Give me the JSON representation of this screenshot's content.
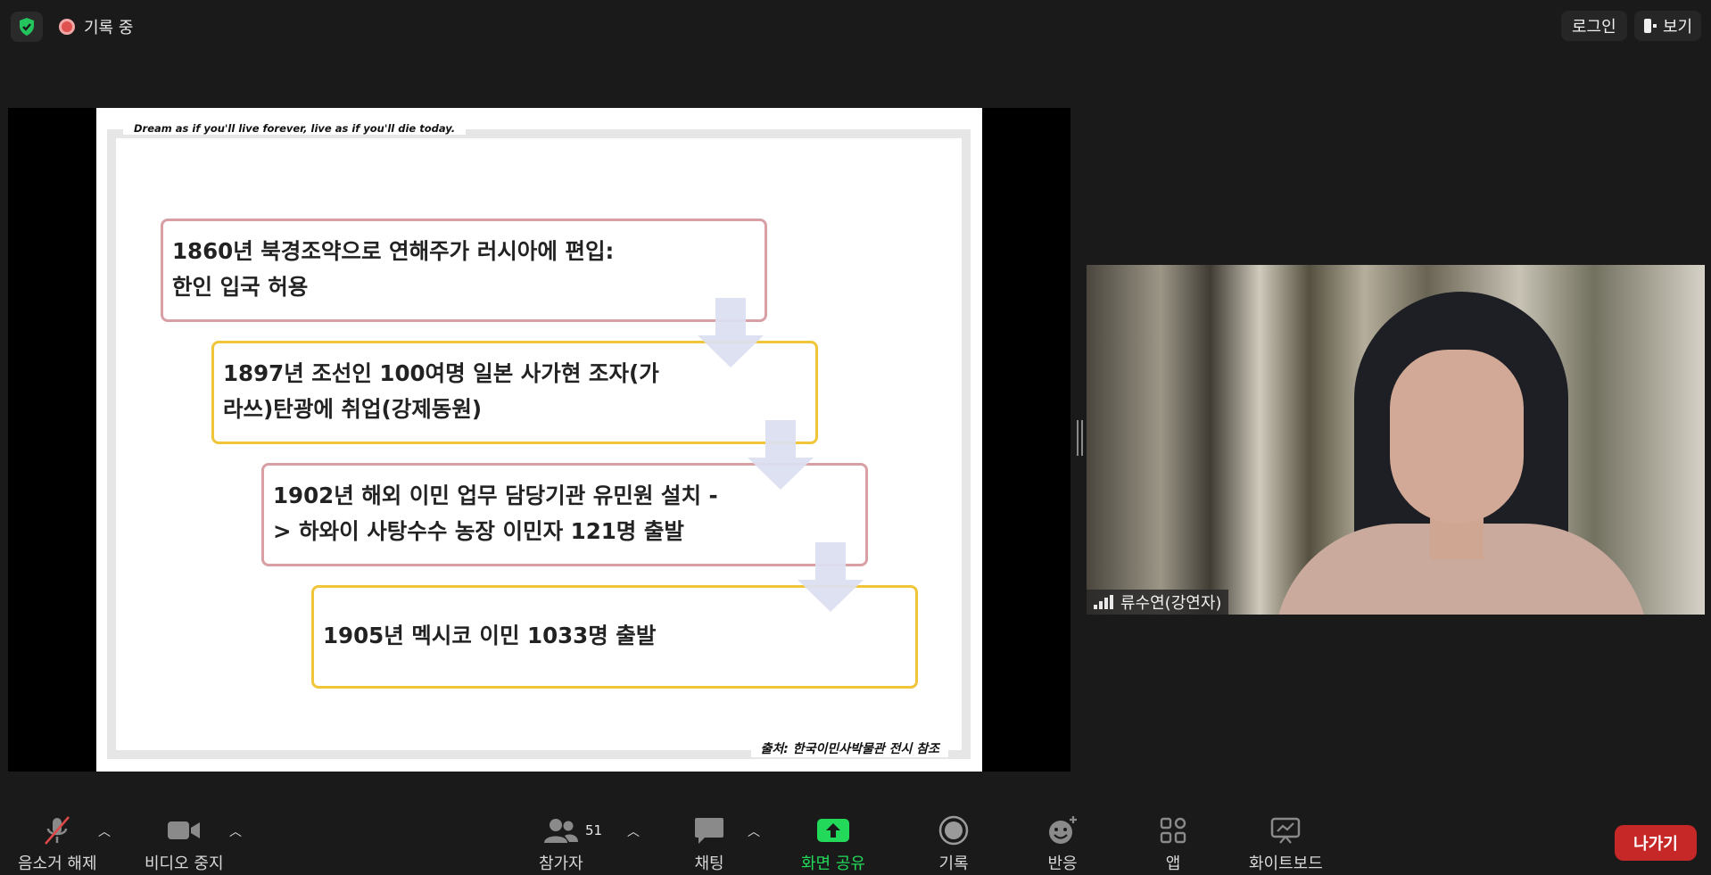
{
  "topbar": {
    "recording_label": "기록 중",
    "login_label": "로그인",
    "view_label": "보기"
  },
  "slide": {
    "quote": "Dream as if you'll live forever, live as if you'll die today.",
    "source": "출처: 한국이민사박물관 전시 참조",
    "items": [
      {
        "line1": "1860년 북경조약으로 연해주가 러시아에 편입:",
        "line2": "한인 입국 허용"
      },
      {
        "line1": "1897년 조선인 100여명 일본 사가현 조자(가",
        "line2": "라쓰)탄광에 취업(강제동원)"
      },
      {
        "line1": "1902년 해외 이민 업무 담당기관 유민원 설치 -",
        "line2": "> 하와이 사탕수수 농장 이민자 121명 출발"
      },
      {
        "line1": "1905년 멕시코 이민 1033명 출발",
        "line2": ""
      }
    ]
  },
  "video": {
    "participant_name": "류수연(강연자)"
  },
  "toolbar": {
    "unmute_label": "음소거 해제",
    "video_label": "비디오 중지",
    "participants_label": "참가자",
    "participants_count": "51",
    "chat_label": "채팅",
    "share_label": "화면 공유",
    "record_label": "기록",
    "reactions_label": "반응",
    "apps_label": "앱",
    "whiteboard_label": "화이트보드",
    "leave_label": "나가기"
  },
  "colors": {
    "share_green": "#23d959",
    "leave_red": "#c62828",
    "shield_green": "#23c45e",
    "box_pink": "#d8a0a5",
    "box_gold": "#f0c53a",
    "arrow": "#dcdff0"
  }
}
